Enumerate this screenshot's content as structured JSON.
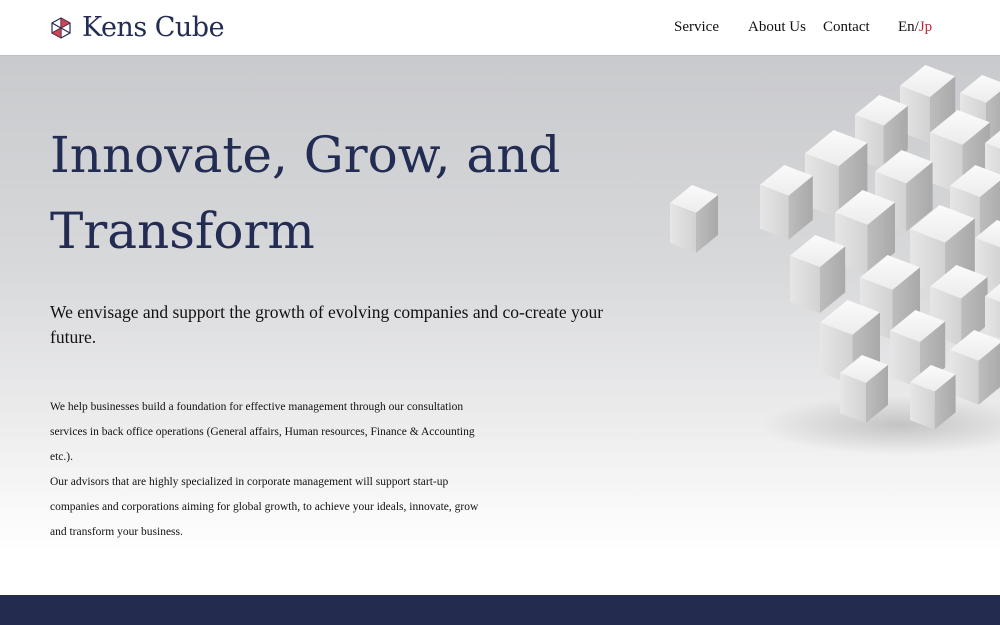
{
  "header": {
    "logo_text": "Kens Cube",
    "nav": {
      "service": "Service",
      "about": "About Us",
      "contact": "Contact"
    },
    "lang": {
      "en": "En",
      "sep": "/",
      "jp": "Jp"
    }
  },
  "hero": {
    "headline_line1": "Innovate, Grow, and",
    "headline_line2": "Transform",
    "subhead": "We envisage and support the growth of evolving companies and co-create your future.",
    "body_lines": [
      "We help businesses build a foundation for effective management through our consultation",
      "services in back office operations (General affairs, Human resources, Finance & Accounting",
      "etc.).",
      "Our advisors that are highly specialized in corporate management will support start-up",
      "companies and corporations aiming for global growth, to achieve your ideals, innovate, grow",
      "and transform your business."
    ]
  },
  "colors": {
    "brand_navy": "#232c52",
    "accent_red": "#c0283a",
    "footer_band": "#232c4f"
  },
  "icons": {
    "logo": "kens-cube-logo-icon",
    "hero_image": "white-cubes-cluster"
  }
}
